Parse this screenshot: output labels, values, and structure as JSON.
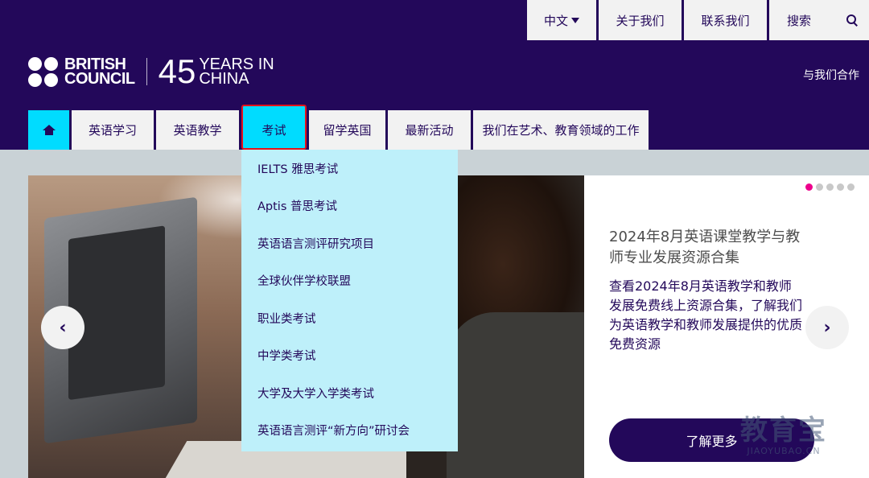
{
  "header": {
    "util_nav": {
      "language": "中文",
      "about": "关于我们",
      "contact": "联系我们",
      "search": "搜索"
    },
    "logo": {
      "line1": "BRITISH",
      "line2": "COUNCIL",
      "years_number": "45",
      "years_line1": "YEARS IN",
      "years_line2": "CHINA"
    },
    "partner_link": "与我们合作"
  },
  "main_nav": {
    "items": [
      {
        "label": "英语学习"
      },
      {
        "label": "英语教学"
      },
      {
        "label": "考试"
      },
      {
        "label": "留学英国"
      },
      {
        "label": "最新活动"
      },
      {
        "label": "我们在艺术、教育领域的工作"
      }
    ],
    "active_index": 2
  },
  "dropdown": {
    "items": [
      "IELTS 雅思考试",
      "Aptis 普思考试",
      "英语语言测评研究项目",
      "全球伙伴学校联盟",
      "职业类考试",
      "中学类考试",
      "大学及大学入学类考试",
      "英语语言测评“新方向”研讨会"
    ]
  },
  "carousel": {
    "title": "2024年8月英语课堂教学与教师专业发展资源合集",
    "description": "查看2024年8月英语教学和教师发展免费线上资源合集，了解我们为英语教学和教师发展提供的优质免费资源",
    "button": "了解更多",
    "slide_count": 5,
    "active_slide": 1,
    "prev_icon": "‹",
    "next_icon": "›"
  },
  "watermark": {
    "big": "教育宝",
    "small": "JIAOYUBAO.CN"
  },
  "colors": {
    "brand_purple": "#23085a",
    "accent_cyan": "#00dcff",
    "dropdown_bg": "#bef0fa",
    "indicator_active": "#ed008c",
    "highlight_border": "#e3131b"
  }
}
